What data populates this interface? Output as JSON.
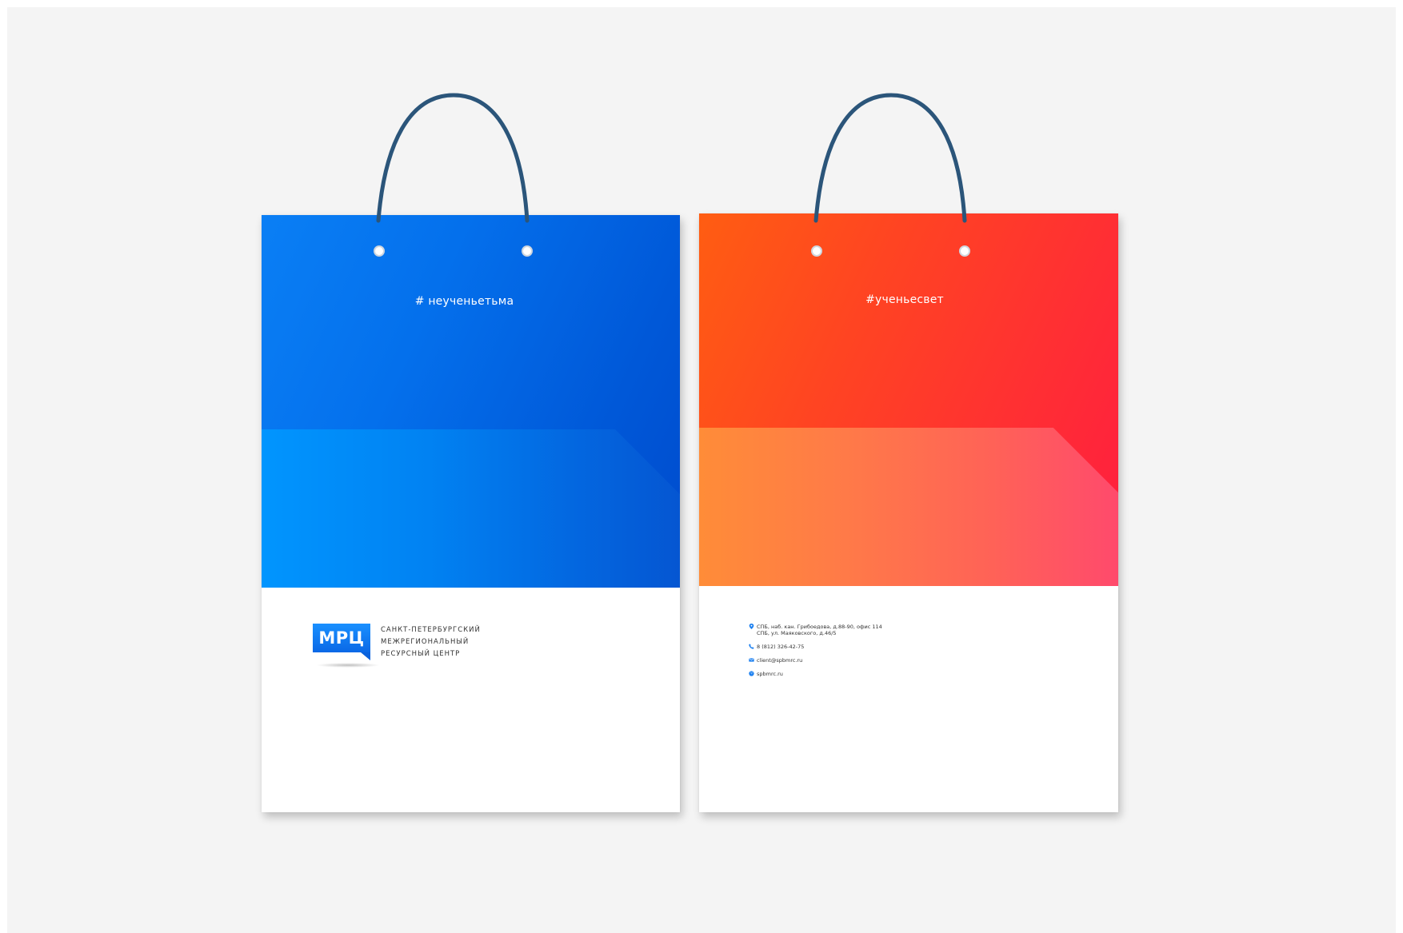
{
  "colors": {
    "background": "#f4f4f4",
    "handle": "#2b557a",
    "blue": "#0470ec",
    "orange_red": "#ff3a2a",
    "logo_blue": "#0a78f0",
    "icon_blue": "#1a7ff0"
  },
  "bags": [
    {
      "hashtag": "# неученьетьма",
      "logo": {
        "mark": "МРЦ",
        "lines": [
          "САНКТ-ПЕТЕРБУРГСКИЙ",
          "МЕЖРЕГИОНАЛЬНЫЙ",
          "РЕСУРСНЫЙ ЦЕНТР"
        ]
      }
    },
    {
      "hashtag": "#ученьесвет",
      "contacts": {
        "address_line1": "СПБ, наб. кан. Грибоедова, д.88-90, офис 114",
        "address_line2": "СПБ, ул. Маяковского, д.46/5",
        "phone": "8 (812) 326-42-75",
        "email": "client@spbmrc.ru",
        "website": "spbmrc.ru"
      }
    }
  ]
}
